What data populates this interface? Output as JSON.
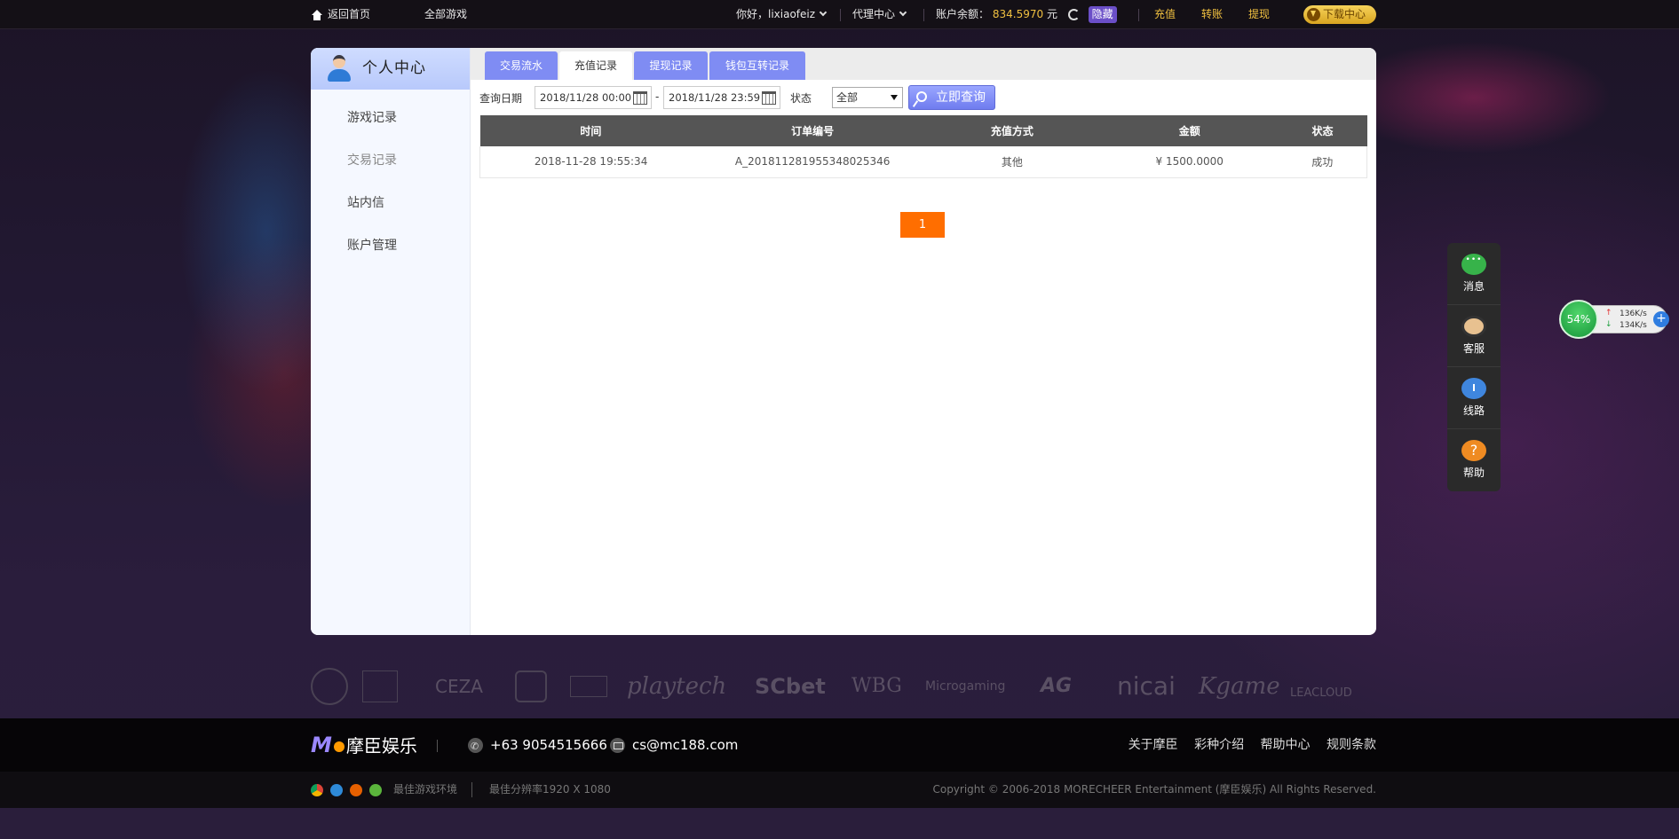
{
  "topbar": {
    "home": "返回首页",
    "all_games": "全部游戏",
    "greeting": "你好，lixiaofeiz",
    "agent_center": "代理中心",
    "balance_label": "账户余额：",
    "balance_value": "834.5970",
    "balance_unit": "元",
    "hide": "隐藏",
    "recharge": "充值",
    "transfer": "转账",
    "withdraw": "提现",
    "download": "下载中心"
  },
  "sidebar": {
    "title": "个人中心",
    "items": [
      "游戏记录",
      "交易记录",
      "站内信",
      "账户管理"
    ]
  },
  "tabs": [
    "交易流水",
    "充值记录",
    "提现记录",
    "钱包互转记录"
  ],
  "filter": {
    "date_label": "查询日期",
    "start_date": "2018/11/28 00:00",
    "separator": "-",
    "end_date": "2018/11/28 23:59",
    "status_label": "状态",
    "status_value": "全部",
    "query_button": "立即查询"
  },
  "table": {
    "headers": [
      "时间",
      "订单编号",
      "充值方式",
      "金额",
      "状态"
    ],
    "rows": [
      [
        "2018-11-28 19:55:34",
        "A_201811281955348025346",
        "其他",
        "¥ 1500.0000",
        "成功"
      ]
    ]
  },
  "pagination": {
    "current": "1"
  },
  "partners": [
    "CEZA",
    "playtech",
    "SCbet",
    "WBG",
    "Microgaming",
    "AG",
    "nicai",
    "Kgame",
    "LEACLOUD"
  ],
  "footer": {
    "logo_text": "摩臣娱乐",
    "phone": "+63 9054515666",
    "email": "cs@mc188.com",
    "links": [
      "关于摩臣",
      "彩种介绍",
      "帮助中心",
      "规则条款"
    ],
    "best_env": "最佳游戏环境",
    "best_res": "最佳分辨率1920 X 1080",
    "copyright": "Copyright © 2006-2018 MORECHEER Entertainment (摩臣娱乐) All Rights Reserved."
  },
  "side_tools": [
    "消息",
    "客服",
    "线路",
    "帮助"
  ],
  "speed_widget": {
    "percent": "54%",
    "up": "136K/s",
    "down": "134K/s"
  },
  "colors": {
    "accent_tab": "#7f8cf3",
    "page_btn": "#ff6e00",
    "gold": "#f0c040"
  }
}
